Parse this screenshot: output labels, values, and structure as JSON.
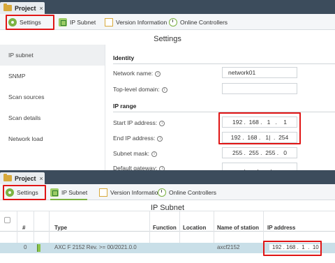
{
  "panel1": {
    "tab": {
      "title": "Project",
      "close": "×"
    },
    "toolbar": [
      {
        "label": "Settings",
        "icon": "settings-icon"
      },
      {
        "label": "IP Subnet",
        "icon": "network-icon"
      },
      {
        "label": "Version Information",
        "icon": "document-icon"
      },
      {
        "label": "Online Controllers",
        "icon": "clock-icon"
      }
    ],
    "heading": "Settings",
    "nav": [
      "IP subnet",
      "SNMP",
      "Scan sources",
      "Scan details",
      "Network load"
    ],
    "identity": {
      "section": "Identity",
      "network_name_label": "Network name:",
      "network_name_value": "network01",
      "top_level_domain_label": "Top-level domain:",
      "top_level_domain_value": ""
    },
    "ip_range": {
      "section": "IP range",
      "start_label": "Start IP address:",
      "start_value": "192 .  168 .   1   .    1",
      "end_label": "End IP address:",
      "end_value": "192 .  168 .   1|  .  254",
      "subnet_label": "Subnet mask:",
      "subnet_value": "255 .  255 .  255 .   0",
      "gateway_label": "Default gateway:",
      "gateway_value": "  .       .       .    "
    },
    "info_glyph": "i"
  },
  "panel2": {
    "tab": {
      "title": "Project",
      "close": "×"
    },
    "toolbar": [
      {
        "label": "Settings",
        "icon": "settings-icon"
      },
      {
        "label": "IP Subnet",
        "icon": "network-icon"
      },
      {
        "label": "Version Information",
        "icon": "document-icon"
      },
      {
        "label": "Online Controllers",
        "icon": "clock-icon"
      }
    ],
    "heading": "IP Subnet",
    "columns": [
      "#",
      "Type",
      "Function",
      "Location",
      "Name of station",
      "IP address"
    ],
    "row": {
      "index": "0",
      "type": "AXC F 2152 Rev. >= 00/2021.0.0",
      "function": "",
      "location": "",
      "station": "axcf2152",
      "ip": "192 . 168 .  1  .  10"
    },
    "search_hint": "S"
  },
  "colors": {
    "accent": "#7cb342",
    "highlight": "#e01515",
    "tabbar": "#3c4c5c",
    "selected_row": "#c9dfe8"
  }
}
